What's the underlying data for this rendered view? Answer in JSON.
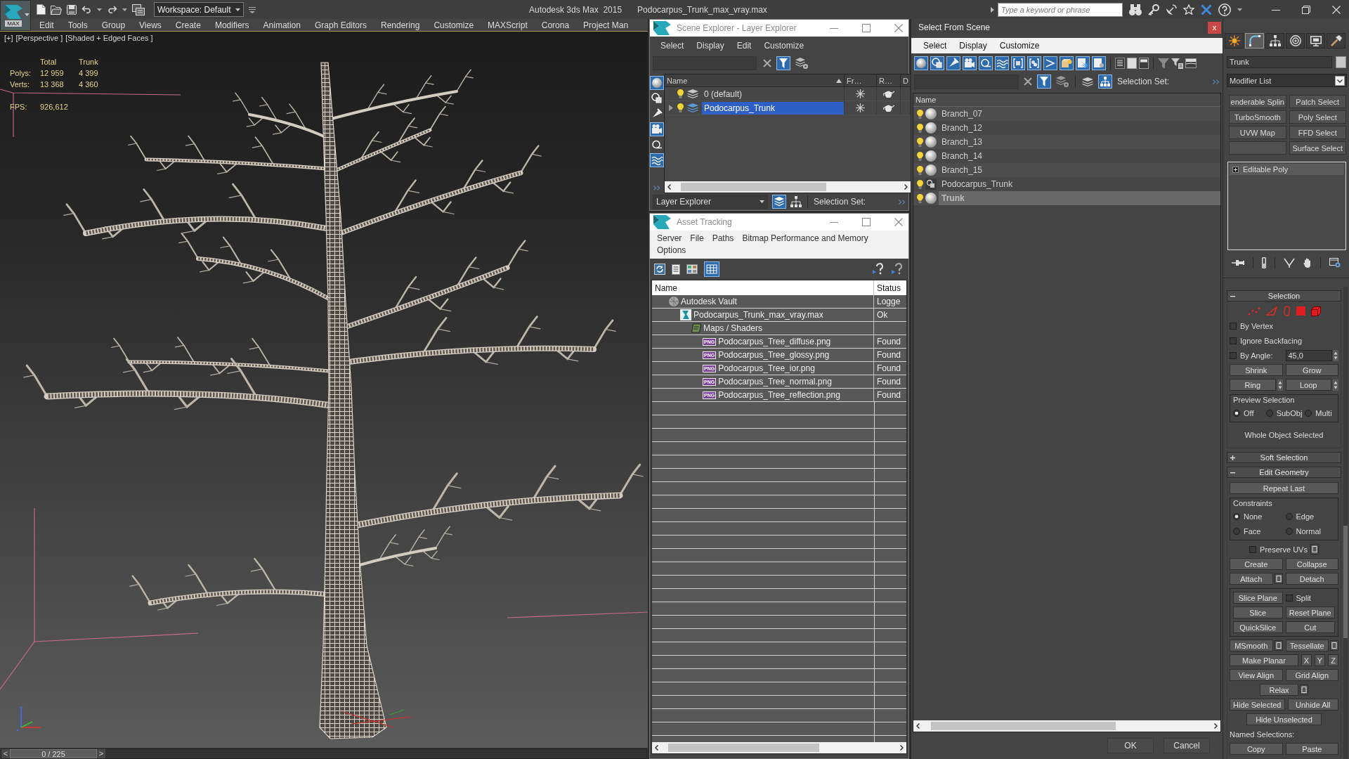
{
  "title_bar": {
    "logo": "MAX",
    "workspace": "Workspace: Default",
    "app_title": "Autodesk 3ds Max  2015",
    "file_name": "Podocarpus_Trunk_max_vray.max",
    "search_placeholder": "Type a keyword or phrase"
  },
  "menu_bar": [
    "Edit",
    "Tools",
    "Group",
    "Views",
    "Create",
    "Modifiers",
    "Animation",
    "Graph Editors",
    "Rendering",
    "Customize",
    "MAXScript",
    "Corona",
    "Project Man"
  ],
  "viewport": {
    "labels": [
      "[+]",
      "[Perspective ]",
      "[Shaded + Edged Faces ]"
    ],
    "stats": {
      "columns": [
        "Total",
        "Trunk"
      ],
      "rows": [
        {
          "label": "Polys:",
          "values": [
            "12 959",
            "4 399"
          ]
        },
        {
          "label": "Verts:",
          "values": [
            "13 368",
            "4 360"
          ]
        }
      ]
    },
    "fps": {
      "label": "FPS:",
      "value": "926,612"
    }
  },
  "time_slider": {
    "previous": "<",
    "frame": "0 / 225",
    "next": ">"
  },
  "scene_explorer": {
    "title": "Scene Explorer - Layer Explorer",
    "menu": [
      "Select",
      "Display",
      "Edit",
      "Customize"
    ],
    "columns": [
      "Name",
      "Fr…",
      "R…",
      "D"
    ],
    "layers": [
      {
        "name": "0 (default)",
        "selected": false
      },
      {
        "name": "Podocarpus_Trunk",
        "expanded": false,
        "selected": true
      }
    ],
    "explorer": "Layer Explorer",
    "selection_set": "Selection Set:"
  },
  "asset_tracking": {
    "title": "Asset Tracking",
    "menu": [
      "Server",
      "File",
      "Paths",
      "Bitmap Performance and Memory",
      "Options"
    ],
    "columns": [
      "Name",
      "Status"
    ],
    "assets": [
      {
        "kind": "vault",
        "name": "Autodesk Vault",
        "status": "Logge",
        "children": [
          {
            "kind": "scene",
            "name": "Podocarpus_Trunk_max_vray.max",
            "status": "Ok",
            "children": [
              {
                "kind": "folder",
                "name": "Maps / Shaders",
                "children": [
                  {
                    "kind": "image",
                    "badge": "PNG",
                    "name": "Podocarpus_Tree_diffuse.png",
                    "status": "Found"
                  },
                  {
                    "kind": "image",
                    "badge": "PNG",
                    "name": "Podocarpus_Tree_glossy.png",
                    "status": "Found"
                  },
                  {
                    "kind": "image",
                    "badge": "PNG",
                    "name": "Podocarpus_Tree_ior.png",
                    "status": "Found"
                  },
                  {
                    "kind": "image",
                    "badge": "PNG",
                    "name": "Podocarpus_Tree_normal.png",
                    "status": "Found"
                  },
                  {
                    "kind": "image",
                    "badge": "PNG",
                    "name": "Podocarpus_Tree_reflection.png",
                    "status": "Found"
                  }
                ]
              }
            ]
          }
        ]
      }
    ]
  },
  "select_from_scene": {
    "title": "Select From Scene",
    "close": "x",
    "menu": [
      "Select",
      "Display",
      "Customize"
    ],
    "selection_set": "Selection Set:",
    "column": "Name",
    "objects": [
      {
        "name": "Branch_07",
        "kind": "geometry",
        "selected": false
      },
      {
        "name": "Branch_12",
        "kind": "geometry",
        "selected": false
      },
      {
        "name": "Branch_13",
        "kind": "geometry",
        "selected": false
      },
      {
        "name": "Branch_14",
        "kind": "geometry",
        "selected": false
      },
      {
        "name": "Branch_15",
        "kind": "geometry",
        "selected": false
      },
      {
        "name": "Podocarpus_Trunk",
        "kind": "group",
        "selected": false
      },
      {
        "name": "Trunk",
        "kind": "geometry",
        "selected": true
      }
    ],
    "buttons": [
      "OK",
      "Cancel"
    ]
  },
  "command_panel": {
    "tabs": [
      {
        "kind": "create",
        "selected": false
      },
      {
        "kind": "modify",
        "selected": true
      },
      {
        "kind": "hierarchy",
        "selected": false
      },
      {
        "kind": "motion",
        "selected": false
      },
      {
        "kind": "display",
        "selected": false
      },
      {
        "kind": "utilities",
        "selected": false
      }
    ],
    "object_name": "Trunk",
    "modifier_list": "Modifier List",
    "modifier_buttons": [
      {
        "kind": "text",
        "label": "enderable Splin"
      },
      {
        "kind": "text",
        "label": "Patch Select"
      },
      {
        "kind": "text",
        "label": "TurboSmooth"
      },
      {
        "kind": "text",
        "label": "Poly Select"
      },
      {
        "kind": "text",
        "label": "UVW Map"
      },
      {
        "kind": "text",
        "label": "FFD Select"
      },
      {
        "kind": "blank"
      },
      {
        "kind": "text",
        "label": "Surface Select"
      }
    ],
    "stack": [
      {
        "name": "Editable Poly",
        "expanded": false
      }
    ],
    "rollouts": [
      {
        "title": "Selection",
        "expanded": true,
        "rows": [
          {
            "kind": "subobjects"
          },
          {
            "kind": "controls",
            "items": [
              {
                "kind": "check",
                "label": "By Vertex",
                "checked": false
              }
            ]
          },
          {
            "kind": "controls",
            "items": [
              {
                "kind": "check",
                "label": "Ignore Backfacing",
                "checked": false
              }
            ]
          },
          {
            "kind": "controls",
            "items": [
              {
                "kind": "check",
                "label": "By Angle:",
                "checked": false
              },
              {
                "kind": "spinner",
                "value": "45,0"
              }
            ]
          },
          {
            "kind": "controls",
            "items": [
              {
                "kind": "button",
                "label": "Shrink"
              },
              {
                "kind": "button",
                "label": "Grow"
              }
            ]
          },
          {
            "kind": "controls",
            "items": [
              {
                "kind": "spinbutton",
                "label": "Ring"
              },
              {
                "kind": "spinbutton",
                "label": "Loop"
              }
            ]
          },
          {
            "kind": "group",
            "title": "Preview Selection",
            "rows": [
              {
                "kind": "controls",
                "items": [
                  {
                    "kind": "radio",
                    "label": "Off",
                    "selected": true
                  },
                  {
                    "kind": "radio",
                    "label": "SubObj",
                    "selected": false
                  },
                  {
                    "kind": "radio",
                    "label": "Multi",
                    "selected": false
                  }
                ]
              }
            ]
          },
          {
            "kind": "controls",
            "items": [
              {
                "kind": "status",
                "label": "Whole Object Selected"
              }
            ]
          }
        ]
      },
      {
        "title": "Soft Selection",
        "expanded": false
      },
      {
        "title": "Edit Geometry",
        "expanded": true,
        "rows": [
          {
            "kind": "controls",
            "items": [
              {
                "kind": "button",
                "label": "Repeat Last"
              }
            ]
          },
          {
            "kind": "group",
            "title": "Constraints",
            "rows": [
              {
                "kind": "controls",
                "items": [
                  {
                    "kind": "radio",
                    "label": "None",
                    "selected": true
                  },
                  {
                    "kind": "radio",
                    "label": "Edge",
                    "selected": false
                  }
                ]
              },
              {
                "kind": "controls",
                "items": [
                  {
                    "kind": "radio",
                    "label": "Face",
                    "selected": false
                  },
                  {
                    "kind": "radio",
                    "label": "Normal",
                    "selected": false
                  }
                ]
              }
            ]
          },
          {
            "kind": "centered",
            "items": [
              {
                "kind": "check",
                "label": "Preserve UVs",
                "checked": false
              },
              {
                "kind": "settings"
              }
            ]
          },
          {
            "kind": "controls",
            "items": [
              {
                "kind": "button",
                "label": "Create"
              },
              {
                "kind": "button",
                "label": "Collapse"
              }
            ]
          },
          {
            "kind": "controls",
            "items": [
              {
                "kind": "button",
                "label": "Attach",
                "settings": true
              },
              {
                "kind": "button",
                "label": "Detach"
              }
            ]
          },
          {
            "kind": "group",
            "rows": [
              {
                "kind": "controls",
                "items": [
                  {
                    "kind": "button",
                    "label": "Slice Plane"
                  },
                  {
                    "kind": "check",
                    "label": "Split",
                    "checked": false
                  }
                ]
              },
              {
                "kind": "controls",
                "items": [
                  {
                    "kind": "button",
                    "label": "Slice"
                  },
                  {
                    "kind": "button",
                    "label": "Reset Plane"
                  }
                ]
              },
              {
                "kind": "controls",
                "items": [
                  {
                    "kind": "button",
                    "label": "QuickSlice"
                  },
                  {
                    "kind": "button",
                    "label": "Cut"
                  }
                ]
              }
            ]
          },
          {
            "kind": "controls",
            "items": [
              {
                "kind": "button",
                "label": "MSmooth",
                "settings": true
              },
              {
                "kind": "button",
                "label": "Tessellate",
                "settings": true
              }
            ]
          },
          {
            "kind": "controls",
            "items": [
              {
                "kind": "button",
                "label": "Make Planar"
              },
              {
                "kind": "axis",
                "label": "X"
              },
              {
                "kind": "axis",
                "label": "Y"
              },
              {
                "kind": "axis",
                "label": "Z"
              }
            ]
          },
          {
            "kind": "controls",
            "items": [
              {
                "kind": "button",
                "label": "View Align"
              },
              {
                "kind": "button",
                "label": "Grid Align"
              }
            ]
          },
          {
            "kind": "centered",
            "items": [
              {
                "kind": "button",
                "label": "Relax",
                "settings": true
              }
            ]
          },
          {
            "kind": "controls",
            "items": [
              {
                "kind": "button",
                "label": "Hide Selected"
              },
              {
                "kind": "button",
                "label": "Unhide All"
              }
            ]
          },
          {
            "kind": "centered",
            "items": [
              {
                "kind": "button",
                "label": "Hide Unselected"
              }
            ]
          },
          {
            "kind": "controls",
            "items": [
              {
                "kind": "label",
                "label": "Named Selections:"
              }
            ]
          },
          {
            "kind": "controls",
            "items": [
              {
                "kind": "button",
                "label": "Copy"
              },
              {
                "kind": "button",
                "label": "Paste"
              }
            ]
          }
        ]
      }
    ]
  }
}
